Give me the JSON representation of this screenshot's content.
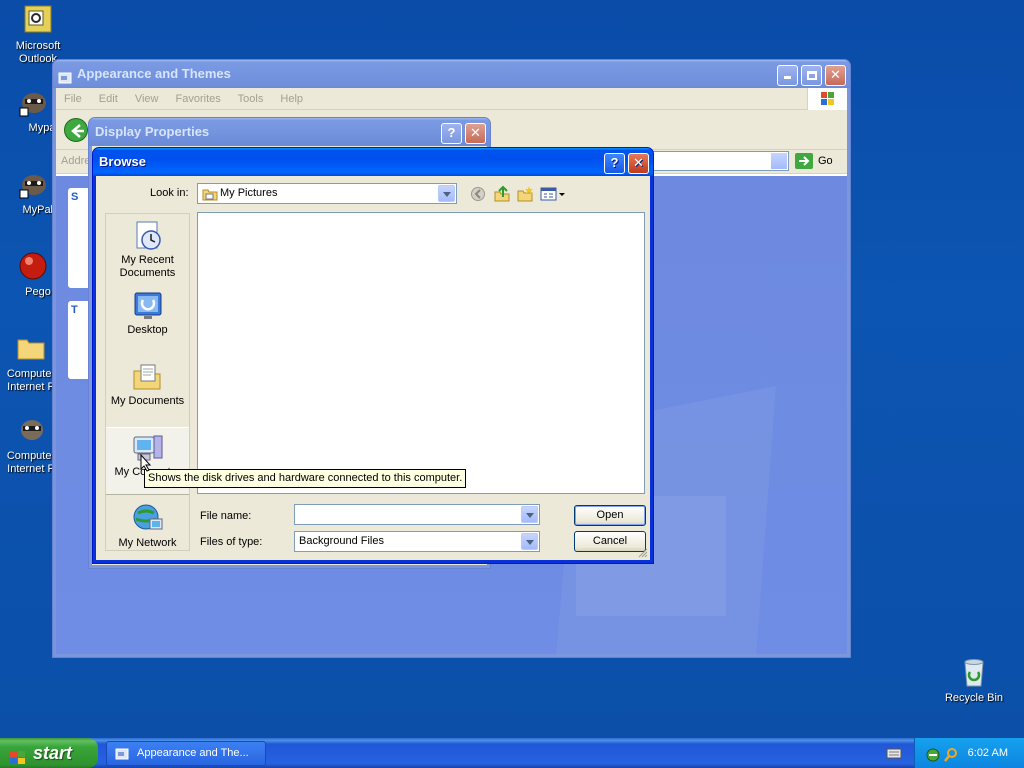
{
  "desktop": {
    "icons": [
      {
        "label": [
          "Microsoft",
          "Outlook"
        ]
      },
      {
        "label": [
          "Mypa"
        ]
      },
      {
        "label": [
          "MyPal c"
        ]
      },
      {
        "label": [
          "Pego"
        ]
      },
      {
        "label": [
          "Computer",
          "Internet P"
        ]
      },
      {
        "label": [
          "Computer",
          "Internet P"
        ]
      }
    ],
    "recycle_bin": "Recycle Bin"
  },
  "appearance_window": {
    "title": "Appearance and Themes",
    "menu": [
      "File",
      "Edit",
      "View",
      "Favorites",
      "Tools",
      "Help"
    ],
    "address_label": "Addre",
    "go_label": "Go",
    "panel_letters": [
      "S",
      "T"
    ]
  },
  "display_properties": {
    "title": "Display Properties"
  },
  "browse": {
    "title": "Browse",
    "look_in_label": "Look in:",
    "look_in_value": "My Pictures",
    "places": [
      "My Recent Documents",
      "Desktop",
      "My Documents",
      "My Computer",
      "My Network"
    ],
    "file_name_label": "File name:",
    "file_name_value": "",
    "files_of_type_label": "Files of type:",
    "files_of_type_value": "Background Files",
    "open_label": "Open",
    "cancel_label": "Cancel",
    "tooltip": "Shows the disk drives and hardware connected to this computer."
  },
  "taskbar": {
    "start_label": "start",
    "task_button": "Appearance and The...",
    "clock": "6:02 AM"
  }
}
